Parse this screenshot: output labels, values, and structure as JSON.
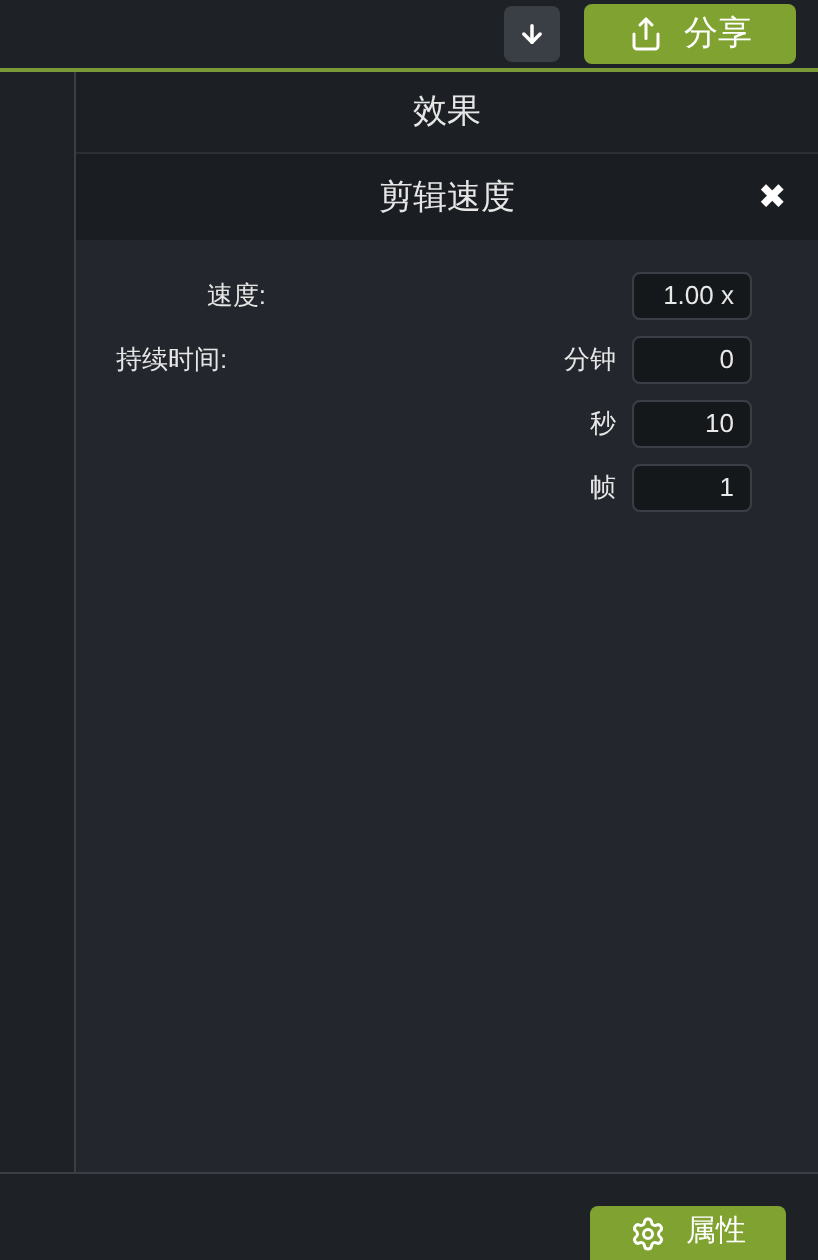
{
  "toolbar": {
    "share_button": "分享"
  },
  "panel": {
    "title": "效果",
    "section_title": "剪辑速度",
    "close": "✖"
  },
  "speed": {
    "label": "速度:",
    "value": "1.00 x"
  },
  "duration": {
    "label": "持续时间:",
    "fields": [
      {
        "unit": "分钟",
        "value": "0"
      },
      {
        "unit": "秒",
        "value": "10"
      },
      {
        "unit": "帧",
        "value": "1"
      }
    ]
  },
  "bottom_bar": {
    "properties_button": "属性"
  }
}
